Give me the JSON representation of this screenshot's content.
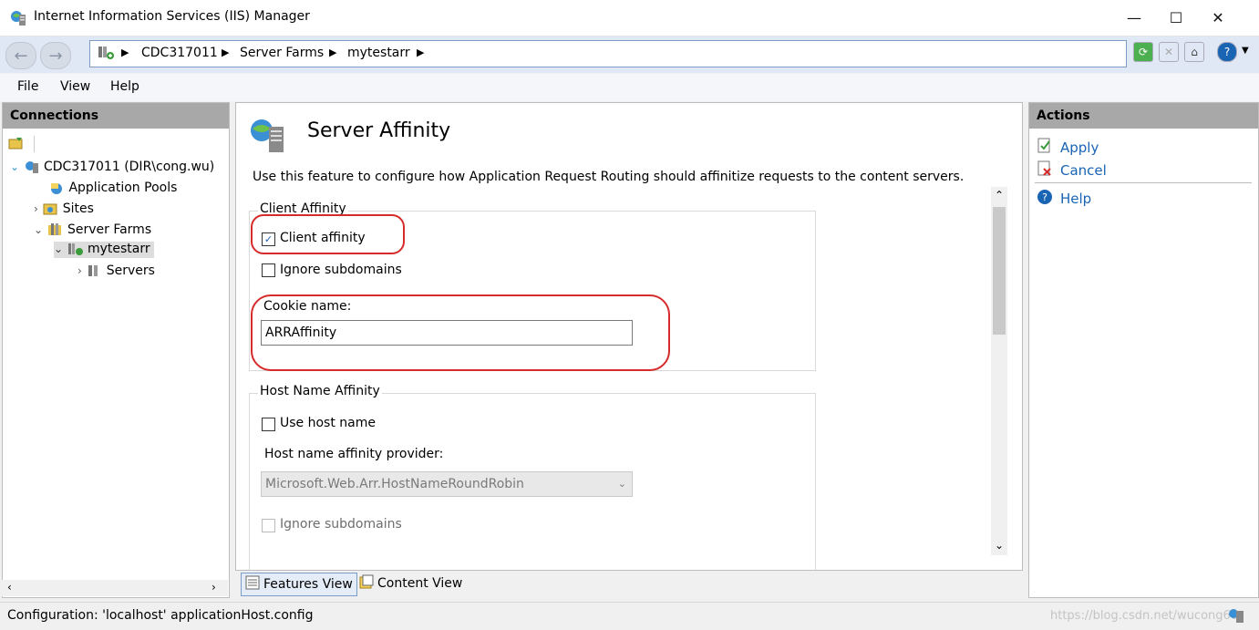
{
  "window": {
    "title": "Internet Information Services (IIS) Manager",
    "minimize_glyph": "—",
    "maximize_glyph": "☐",
    "close_glyph": "✕"
  },
  "address": {
    "crumbs": [
      "CDC317011",
      "Server Farms",
      "mytestarr"
    ]
  },
  "menu": {
    "file": "File",
    "view": "View",
    "help": "Help"
  },
  "connections": {
    "header": "Connections",
    "tree": {
      "server": "CDC317011 (DIR\\cong.wu)",
      "app_pools": "Application Pools",
      "sites": "Sites",
      "server_farms": "Server Farms",
      "farm": "mytestarr",
      "servers": "Servers"
    }
  },
  "feature": {
    "title": "Server Affinity",
    "description": "Use this feature to configure how Application Request Routing should affinitize requests to the content servers.",
    "client_affinity": {
      "group_label": "Client Affinity",
      "client_affinity_label": "Client affinity",
      "client_affinity_checked": true,
      "ignore_subdomains_label": "Ignore subdomains",
      "ignore_subdomains_checked": false,
      "cookie_name_label": "Cookie name:",
      "cookie_name_value": "ARRAffinity"
    },
    "host_name_affinity": {
      "group_label": "Host Name Affinity",
      "use_host_name_label": "Use host name",
      "use_host_name_checked": false,
      "provider_label": "Host name affinity provider:",
      "provider_value": "Microsoft.Web.Arr.HostNameRoundRobin",
      "ignore_subdomains_label": "Ignore subdomains"
    }
  },
  "bottom_tabs": {
    "features_view": "Features View",
    "content_view": "Content View"
  },
  "actions": {
    "header": "Actions",
    "apply": "Apply",
    "cancel": "Cancel",
    "help": "Help"
  },
  "status": {
    "text": "Configuration: 'localhost' applicationHost.config",
    "watermark": "https://blog.csdn.net/wucong60"
  },
  "colors": {
    "accent": "#1a64b4",
    "annotation_red": "#d62b2b",
    "pane_header": "#a8a8a8"
  }
}
